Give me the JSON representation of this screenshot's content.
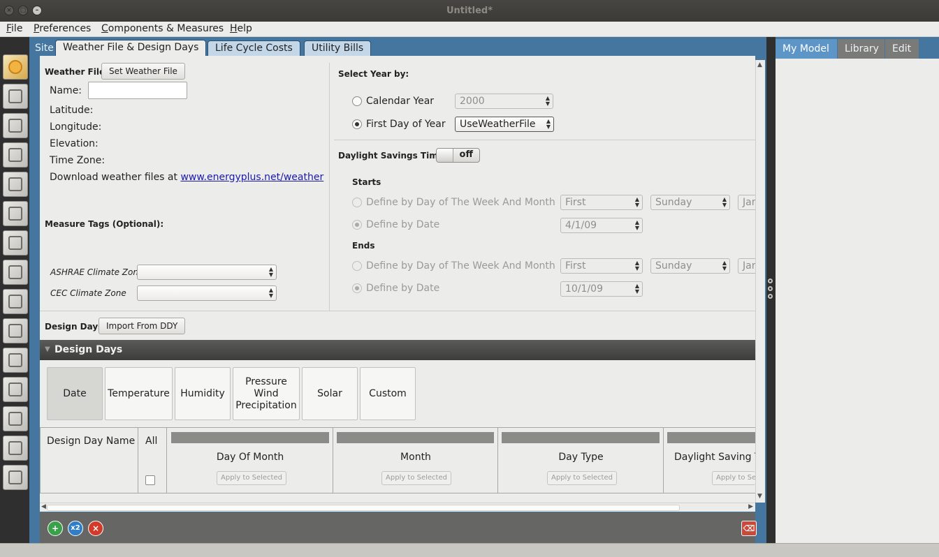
{
  "window": {
    "title": "Untitled*"
  },
  "menu": [
    "File",
    "Preferences",
    "Components & Measures",
    "Help"
  ],
  "menu_underline": [
    "F",
    "P",
    "C",
    "H"
  ],
  "menu_rest": [
    "ile",
    "references",
    "omponents & Measures",
    "elp"
  ],
  "vtoolbar": {
    "icons": [
      "site-icon",
      "schedules-icon",
      "constructions-icon",
      "loads-icon",
      "space-types-icon",
      "geometry-icon",
      "facility-icon",
      "spaces-icon",
      "thermal-zones-icon",
      "hvac-systems-icon",
      "variables-icon",
      "simulation-settings-icon",
      "scripts-icon",
      "run-icon",
      "results-icon"
    ]
  },
  "tabs": {
    "site_label": "Site",
    "items": [
      "Weather File & Design Days",
      "Life Cycle Costs",
      "Utility Bills"
    ]
  },
  "weather": {
    "section_label": "Weather File",
    "set_button": "Set Weather File",
    "name_label": "Name:",
    "name_value": "",
    "latitude_label": "Latitude:",
    "longitude_label": "Longitude:",
    "elevation_label": "Elevation:",
    "timezone_label": "Time Zone:",
    "download_text": "Download weather files at ",
    "download_link": "www.energyplus.net/weather"
  },
  "measure_tags": {
    "title": "Measure Tags (Optional):",
    "ashrae_label": "ASHRAE Climate Zone",
    "ashrae_value": "",
    "cec_label": "CEC Climate Zone",
    "cec_value": ""
  },
  "year": {
    "title": "Select Year by:",
    "calendar_label": "Calendar Year",
    "calendar_value": "2000",
    "first_day_label": "First Day of Year",
    "first_day_value": "UseWeatherFile",
    "selected": "first_day"
  },
  "dst": {
    "title": "Daylight Savings Time:",
    "toggle": "off",
    "starts": "Starts",
    "ends": "Ends",
    "define_week": "Define by Day of The Week And Month",
    "define_date": "Define by Date",
    "start_week_nth": "First",
    "start_week_day": "Sunday",
    "start_week_month": "Jan",
    "start_date": "4/1/09",
    "end_week_nth": "First",
    "end_week_day": "Sunday",
    "end_week_month": "Jan",
    "end_date": "10/1/09"
  },
  "design_days": {
    "label": "Design Days",
    "import_button": "Import From DDY",
    "header": "Design Days",
    "filters": [
      "Date",
      "Temperature",
      "Humidity",
      "Pressure\nWind\nPrecipitation",
      "Solar",
      "Custom"
    ],
    "filter_selected": "Date",
    "columns": {
      "name": "Design Day Name",
      "all": "All",
      "day_of_month": "Day Of Month",
      "month": "Month",
      "day_type": "Day Type",
      "dst": "Daylight Saving T"
    },
    "apply_label": "Apply to Selected",
    "apply_label_cut": "Apply to Sel"
  },
  "right_panel": {
    "tabs": [
      "My Model",
      "Library",
      "Edit"
    ],
    "active": "My Model"
  },
  "colors": {
    "accent_blue": "#45769f",
    "tab_active_blue": "#5d95c6",
    "header_dark": "#3c3c3a",
    "add_green": "#3aa04a",
    "copy_blue": "#2f7ec7",
    "delete_red": "#d23a2a"
  }
}
